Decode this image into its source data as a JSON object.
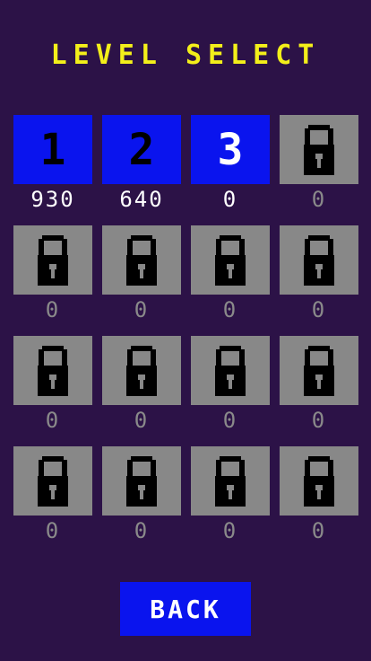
{
  "screen": {
    "title": "LEVEL SELECT",
    "back_label": "BACK"
  },
  "colors": {
    "background": "#2c1247",
    "title": "#f3ef1a",
    "unlocked_tile": "#0a14ee",
    "locked_tile": "#888888",
    "score_unlocked": "#ffffff",
    "score_locked": "#8a8a8a"
  },
  "levels": [
    {
      "label": "1",
      "score": "930",
      "locked": false,
      "selected": false
    },
    {
      "label": "2",
      "score": "640",
      "locked": false,
      "selected": false
    },
    {
      "label": "3",
      "score": "0",
      "locked": false,
      "selected": true
    },
    {
      "label": "",
      "score": "0",
      "locked": true,
      "icon": "padlock-icon"
    },
    {
      "label": "",
      "score": "0",
      "locked": true,
      "icon": "padlock-icon"
    },
    {
      "label": "",
      "score": "0",
      "locked": true,
      "icon": "padlock-icon"
    },
    {
      "label": "",
      "score": "0",
      "locked": true,
      "icon": "padlock-icon"
    },
    {
      "label": "",
      "score": "0",
      "locked": true,
      "icon": "padlock-icon"
    },
    {
      "label": "",
      "score": "0",
      "locked": true,
      "icon": "padlock-icon"
    },
    {
      "label": "",
      "score": "0",
      "locked": true,
      "icon": "padlock-icon"
    },
    {
      "label": "",
      "score": "0",
      "locked": true,
      "icon": "padlock-icon"
    },
    {
      "label": "",
      "score": "0",
      "locked": true,
      "icon": "padlock-icon"
    },
    {
      "label": "",
      "score": "0",
      "locked": true,
      "icon": "padlock-icon"
    },
    {
      "label": "",
      "score": "0",
      "locked": true,
      "icon": "padlock-icon"
    },
    {
      "label": "",
      "score": "0",
      "locked": true,
      "icon": "padlock-icon"
    },
    {
      "label": "",
      "score": "0",
      "locked": true,
      "icon": "padlock-icon"
    }
  ]
}
